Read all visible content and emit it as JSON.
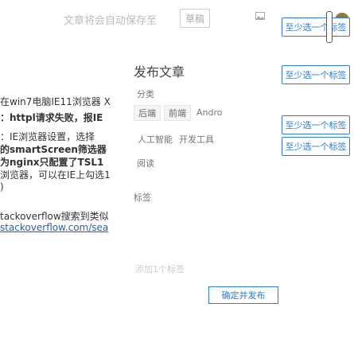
{
  "toolbar": {
    "ghost_text": "文章将会自动保存至",
    "draft_label": "草稿",
    "image_icon": "image-icon"
  },
  "article": {
    "lines": [
      "在win7电脑IE11浏览器 X",
      "：httpl请求失败，报IE",
      "：IE浏览器设置，选择",
      "的smartScreen筛选器",
      "为nginx只配置了TSL1",
      "浏览器，可以在IE上勾选1",
      ")",
      "tackoverflow搜索到类似",
      "stackoverflow.com/sea"
    ]
  },
  "publish": {
    "title": "发布文章",
    "category_label": "分类",
    "tags": [
      "后端",
      "前端",
      "Andro"
    ],
    "type_labels": [
      "人工智能",
      "开发工具"
    ],
    "more_label": "阅读",
    "extra_label": "标签",
    "hint": "添加1个标签"
  },
  "options": {
    "buttons": [
      "至少选一个标签",
      "至少选一个标签",
      "至少选一个标签",
      "至少选一个标签"
    ]
  },
  "confirm": {
    "label": "确定并发布"
  },
  "colors": {
    "accent": "#2e7dd6",
    "link": "#2a5db0"
  }
}
